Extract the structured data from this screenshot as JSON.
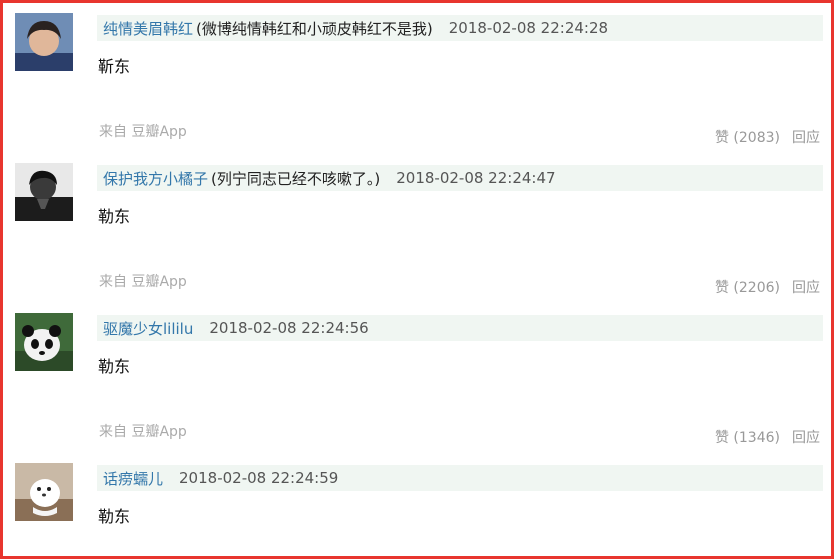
{
  "comments": [
    {
      "author": "纯情美眉韩红",
      "signature": "(微博纯情韩红和小顽皮韩红不是我)",
      "timestamp": "2018-02-08 22:24:28",
      "text": "靳东",
      "source": "来自 豆瓣App",
      "likes": "赞 (2083)",
      "reply": "回应"
    },
    {
      "author": "保护我方小橘子",
      "signature": "(列宁同志已经不咳嗽了。)",
      "timestamp": "2018-02-08 22:24:47",
      "text": "勒东",
      "source": "来自 豆瓣App",
      "likes": "赞 (2206)",
      "reply": "回应"
    },
    {
      "author": "驱魔少女lililu",
      "signature": "",
      "timestamp": "2018-02-08 22:24:56",
      "text": "勒东",
      "source": "来自 豆瓣App",
      "likes": "赞 (1346)",
      "reply": "回应"
    },
    {
      "author": "话痨蠕儿",
      "signature": "",
      "timestamp": "2018-02-08 22:24:59",
      "text": "勒东"
    }
  ],
  "colors": {
    "border": "#e8352e",
    "author_link": "#3377aa",
    "header_bg": "#f0f6f2",
    "meta_gray": "#999999"
  }
}
